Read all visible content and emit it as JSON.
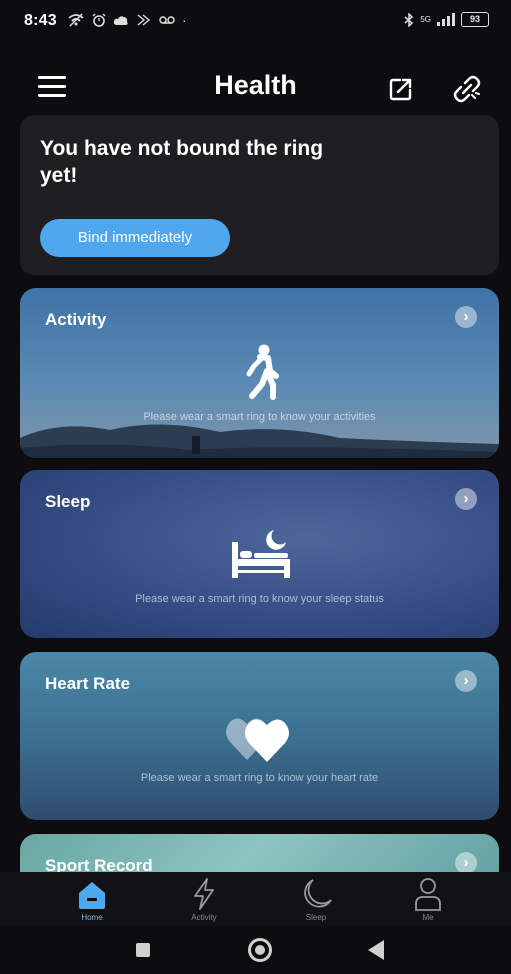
{
  "status_bar": {
    "time": "8:43",
    "left_icons": [
      "wifi-off-icon",
      "alarm-icon",
      "cloud-icon",
      "cast-icon",
      "voicemail-icon"
    ],
    "signal_label": "5G",
    "battery": "93"
  },
  "header": {
    "title": "Health"
  },
  "bind_card": {
    "message": "You have not bound the ring yet!",
    "button_label": "Bind immediately"
  },
  "cards": [
    {
      "title": "Activity",
      "hint": "Please wear a smart ring to know your activities",
      "icon": "walking-person-icon"
    },
    {
      "title": "Sleep",
      "hint": "Please wear a smart ring to know your sleep status",
      "icon": "bed-moon-icon"
    },
    {
      "title": "Heart Rate",
      "hint": "Please wear a smart ring to know your heart rate",
      "icon": "heart-icon"
    },
    {
      "title": "Sport Record",
      "icon": "chevron-right-icon"
    }
  ],
  "bottom_nav": [
    {
      "label": "Home",
      "icon": "home-icon",
      "active": true
    },
    {
      "label": "Activity",
      "icon": "lightning-icon",
      "active": false
    },
    {
      "label": "Sleep",
      "icon": "moon-icon",
      "active": false
    },
    {
      "label": "Me",
      "icon": "person-icon",
      "active": false
    }
  ],
  "colors": {
    "accent": "#4fa7ee",
    "background": "#0d0d10",
    "card": "#1f1f22"
  }
}
